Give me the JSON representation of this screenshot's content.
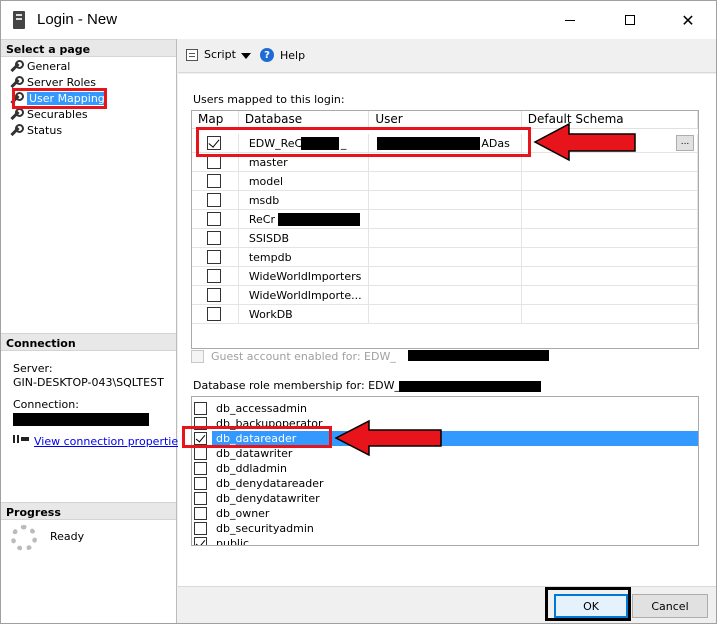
{
  "window": {
    "title": "Login - New",
    "icon": "database-server-icon"
  },
  "left": {
    "select_header": "Select a page",
    "pages": [
      {
        "label": "General",
        "icon": "wrench-icon",
        "active": false
      },
      {
        "label": "Server Roles",
        "icon": "wrench-icon",
        "active": false
      },
      {
        "label": "User Mapping",
        "icon": "wrench-icon",
        "active": true
      },
      {
        "label": "Securables",
        "icon": "wrench-icon",
        "active": false
      },
      {
        "label": "Status",
        "icon": "wrench-icon",
        "active": false
      }
    ],
    "connection_header": "Connection",
    "server_label": "Server:",
    "server_value": "GIN-DESKTOP-043\\SQLTEST",
    "connection_label": "Connection:",
    "view_properties_link": "View connection properties",
    "progress_header": "Progress",
    "progress_status": "Ready"
  },
  "toolbar": {
    "script_label": "Script",
    "help_label": "Help"
  },
  "mapping": {
    "group_label": "Users mapped to this login:",
    "columns": [
      "Map",
      "Database",
      "User",
      "Default Schema"
    ],
    "rows": [
      {
        "map": true,
        "database": "EDW_ReC",
        "database_suffix": "_",
        "user": "ADas",
        "schema": "",
        "has_ellipsis": true
      },
      {
        "map": false,
        "database": "master",
        "user": "",
        "schema": ""
      },
      {
        "map": false,
        "database": "model",
        "user": "",
        "schema": ""
      },
      {
        "map": false,
        "database": "msdb",
        "user": "",
        "schema": ""
      },
      {
        "map": false,
        "database": "ReCr",
        "user": "",
        "schema": ""
      },
      {
        "map": false,
        "database": "SSISDB",
        "user": "",
        "schema": ""
      },
      {
        "map": false,
        "database": "tempdb",
        "user": "",
        "schema": ""
      },
      {
        "map": false,
        "database": "WideWorldImporters",
        "user": "",
        "schema": ""
      },
      {
        "map": false,
        "database": "WideWorldImporte...",
        "user": "",
        "schema": ""
      },
      {
        "map": false,
        "database": "WorkDB",
        "user": "",
        "schema": ""
      }
    ],
    "ellipsis_label": "..."
  },
  "guest": {
    "label": "Guest account enabled for: EDW_",
    "checked": false,
    "enabled": false
  },
  "roles": {
    "group_label": "Database role membership for: EDW_",
    "items": [
      {
        "label": "db_accessadmin",
        "checked": false,
        "selected": false
      },
      {
        "label": "db_backupoperator",
        "checked": false,
        "selected": false
      },
      {
        "label": "db_datareader",
        "checked": true,
        "selected": true
      },
      {
        "label": "db_datawriter",
        "checked": false,
        "selected": false
      },
      {
        "label": "db_ddladmin",
        "checked": false,
        "selected": false
      },
      {
        "label": "db_denydatareader",
        "checked": false,
        "selected": false
      },
      {
        "label": "db_denydatawriter",
        "checked": false,
        "selected": false
      },
      {
        "label": "db_owner",
        "checked": false,
        "selected": false
      },
      {
        "label": "db_securityadmin",
        "checked": false,
        "selected": false
      },
      {
        "label": "public",
        "checked": true,
        "selected": false
      }
    ]
  },
  "footer": {
    "ok_label": "OK",
    "cancel_label": "Cancel"
  },
  "colors": {
    "selection": "#3399ff",
    "annotation_red": "#e8141b",
    "link": "#0000ee"
  }
}
